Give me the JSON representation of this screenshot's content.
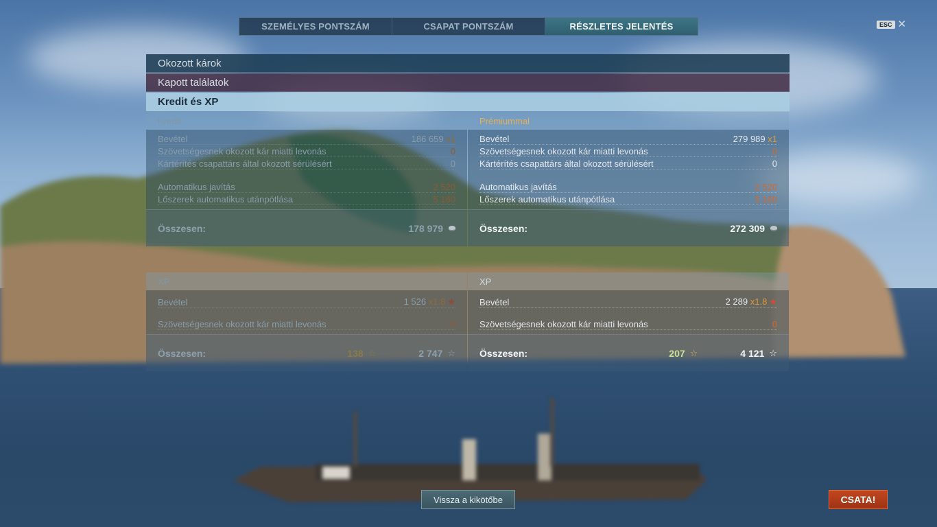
{
  "tabs": [
    {
      "label": "SZEMÉLYES PONTSZÁM",
      "active": false
    },
    {
      "label": "CSAPAT PONTSZÁM",
      "active": false
    },
    {
      "label": "RÉSZLETES JELENTÉS",
      "active": true
    }
  ],
  "close": {
    "key": "ESC",
    "glyph": "✕"
  },
  "sections": {
    "damage": "Okozott károk",
    "received": "Kapott találatok",
    "credits_xp": "Kredit és XP"
  },
  "credit": {
    "left": {
      "header": "Kredit",
      "income_label": "Bevétel",
      "income_value": "186 659",
      "income_mult": "x1",
      "ally_damage_label": "Szövetségesnek okozott kár miatti levonás",
      "ally_damage_value": "0",
      "compensation_label": "Kártérítés csapattárs által okozott sérülésért",
      "compensation_value": "0",
      "repair_label": "Automatikus javítás",
      "repair_value": "2 520",
      "ammo_label": "Lőszerek automatikus utánpótlása",
      "ammo_value": "5 160",
      "total_label": "Összesen:",
      "total_value": "178 979"
    },
    "right": {
      "header": "Prémiummal",
      "income_label": "Bevétel",
      "income_value": "279 989",
      "income_mult": "x1",
      "ally_damage_label": "Szövetségesnek okozott kár miatti levonás",
      "ally_damage_value": "0",
      "compensation_label": "Kártérítés csapattárs által okozott sérülésért",
      "compensation_value": "0",
      "repair_label": "Automatikus javítás",
      "repair_value": "2 520",
      "ammo_label": "Lőszerek automatikus utánpótlása",
      "ammo_value": "5 160",
      "total_label": "Összesen:",
      "total_value": "272 309"
    }
  },
  "xp": {
    "left": {
      "header": "XP",
      "income_label": "Bevétel",
      "income_value": "1 526",
      "income_mult": "x1.8",
      "ally_damage_label": "Szövetségesnek okozott kár miatti levonás",
      "ally_damage_value": "0",
      "total_label": "Összesen:",
      "total_free": "138",
      "total_value": "2 747"
    },
    "right": {
      "header": "XP",
      "income_label": "Bevétel",
      "income_value": "2 289",
      "income_mult": "x1.8",
      "ally_damage_label": "Szövetségesnek okozott kár miatti levonás",
      "ally_damage_value": "0",
      "total_label": "Összesen:",
      "total_free": "207",
      "total_value": "4 121"
    }
  },
  "buttons": {
    "back": "Vissza a kikötőbe",
    "battle": "CSATA!"
  },
  "colors": {
    "accent_tab": "#2f5f70",
    "battle": "#c2461e",
    "premium": "#e2b15a",
    "deduction": "#d06a2c"
  }
}
